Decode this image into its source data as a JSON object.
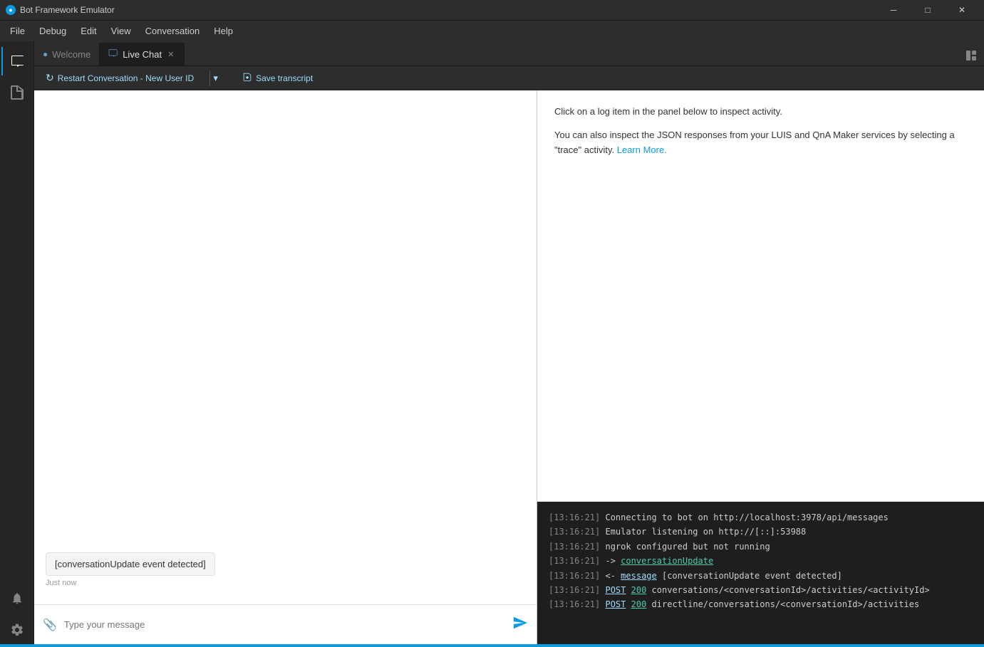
{
  "titlebar": {
    "icon": "●",
    "title": "Bot Framework Emulator",
    "minimize": "─",
    "maximize": "□",
    "close": "✕"
  },
  "menubar": {
    "items": [
      "File",
      "Debug",
      "Edit",
      "View",
      "Conversation",
      "Help"
    ]
  },
  "sidebar": {
    "icons": [
      {
        "name": "chat-icon",
        "symbol": "💬",
        "active": true
      },
      {
        "name": "document-icon",
        "symbol": "📄",
        "active": false
      }
    ],
    "bottom_icons": [
      {
        "name": "bell-icon",
        "symbol": "🔔",
        "active": false
      },
      {
        "name": "settings-icon",
        "symbol": "⚙",
        "active": false
      }
    ]
  },
  "tabs": {
    "welcome": {
      "label": "Welcome",
      "icon": "●"
    },
    "livechat": {
      "label": "Live Chat",
      "icon": "💬",
      "active": true,
      "closeable": true
    }
  },
  "toolbar": {
    "restart_btn": "Restart Conversation - New User ID",
    "restart_icon": "↻",
    "dropdown_icon": "▾",
    "save_icon": "💾",
    "save_btn": "Save transcript"
  },
  "inspector": {
    "hint1": "Click on a log item in the panel below to inspect activity.",
    "hint2": "You can also inspect the JSON responses from your LUIS and QnA Maker services by selecting a \"trace\" activity.",
    "learn_more": "Learn More."
  },
  "logs": [
    {
      "time": "[13:16:21]",
      "content": "Connecting to bot on http://localhost:3978/api/messages",
      "type": "plain"
    },
    {
      "time": "[13:16:21]",
      "content": "Emulator listening on http://[::]:53988",
      "type": "plain"
    },
    {
      "time": "[13:16:21]",
      "content": "ngrok configured but not running",
      "type": "plain"
    },
    {
      "time": "[13:16:21]",
      "prefix": "->",
      "link": "conversationUpdate",
      "type": "link"
    },
    {
      "time": "[13:16:21]",
      "prefix": "<-",
      "link": "message",
      "suffix": "[conversationUpdate event detected]",
      "type": "link2"
    },
    {
      "time": "[13:16:21]",
      "post": "POST",
      "code": "200",
      "path": "conversations/<conversationId>/activities/<activityId>",
      "type": "post"
    },
    {
      "time": "[13:16:21]",
      "post": "POST",
      "code": "200",
      "path": "directline/conversations/<conversationId>/activities",
      "type": "post"
    }
  ],
  "chat": {
    "bubble_text": "[conversationUpdate event detected]",
    "timestamp": "Just now",
    "input_placeholder": "Type your message"
  }
}
